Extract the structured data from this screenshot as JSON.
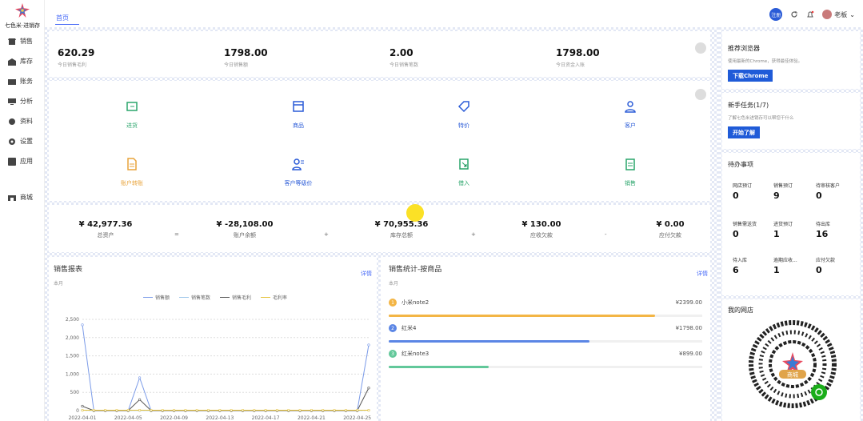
{
  "app": {
    "brand": "七色米·进销存"
  },
  "sidebar": {
    "items": [
      {
        "label": "销售",
        "icon": "store-icon"
      },
      {
        "label": "库存",
        "icon": "warehouse-icon"
      },
      {
        "label": "账务",
        "icon": "wallet-icon"
      },
      {
        "label": "分析",
        "icon": "monitor-icon"
      },
      {
        "label": "资料",
        "icon": "data-icon"
      },
      {
        "label": "设置",
        "icon": "gear-icon"
      },
      {
        "label": "应用",
        "icon": "app-icon"
      },
      {
        "label": "商城",
        "icon": "shop-icon"
      }
    ]
  },
  "topbar": {
    "breadcrumb": "首页",
    "badge": "注册",
    "user": "老板"
  },
  "stats": [
    {
      "value": "620.29",
      "label": "今日销售毛利"
    },
    {
      "value": "1798.00",
      "label": "今日销售额"
    },
    {
      "value": "2.00",
      "label": "今日销售笔数"
    },
    {
      "value": "1798.00",
      "label": "今日资金入账"
    }
  ],
  "quick": [
    {
      "label": "进货",
      "color": "#2aa56b"
    },
    {
      "label": "商品",
      "color": "#2a5bd7"
    },
    {
      "label": "特价",
      "color": "#2a5bd7"
    },
    {
      "label": "客户",
      "color": "#2a5bd7"
    },
    {
      "label": "账户转账",
      "color": "#e8a33a"
    },
    {
      "label": "客户等级价",
      "color": "#2a5bd7"
    },
    {
      "label": "借入",
      "color": "#2aa56b"
    },
    {
      "label": "销售",
      "color": "#2aa56b"
    }
  ],
  "balances": [
    {
      "value": "¥ 42,977.36",
      "label": "总资产"
    },
    {
      "value": "¥ -28,108.00",
      "label": "账户余额"
    },
    {
      "value": "¥ 70,955.36",
      "label": "库存总额"
    },
    {
      "value": "¥ 130.00",
      "label": "应收欠款"
    },
    {
      "value": "¥ 0.00",
      "label": "应付欠款"
    }
  ],
  "balance_ops": [
    "=",
    "+",
    "+",
    "-"
  ],
  "sales_report": {
    "title": "销售报表",
    "period": "本月",
    "detail": "详情",
    "chart_data": {
      "type": "line",
      "x": [
        "2022-04-01",
        "2022-04-05",
        "2022-04-09",
        "2022-04-13",
        "2022-04-17",
        "2022-04-21",
        "2022-04-25"
      ],
      "yticks": [
        "2,500",
        "2,000",
        "1,500",
        "1,000",
        "500",
        "0"
      ],
      "ylim": [
        0,
        2500
      ],
      "series": [
        {
          "name": "销售额",
          "color": "#7b9be8",
          "values": [
            2350,
            0,
            0,
            0,
            0,
            900,
            0,
            0,
            0,
            0,
            0,
            0,
            0,
            0,
            0,
            0,
            0,
            0,
            0,
            0,
            0,
            0,
            0,
            0,
            0,
            1798
          ]
        },
        {
          "name": "销售笔数",
          "color": "#9dc5ea",
          "values": [
            2,
            0,
            0,
            0,
            0,
            1,
            0,
            0,
            0,
            0,
            0,
            0,
            0,
            0,
            0,
            0,
            0,
            0,
            0,
            0,
            0,
            0,
            0,
            0,
            0,
            2
          ]
        },
        {
          "name": "销售毛利",
          "color": "#555555",
          "values": [
            120,
            0,
            0,
            0,
            0,
            300,
            0,
            0,
            0,
            0,
            0,
            0,
            0,
            0,
            0,
            0,
            0,
            0,
            0,
            0,
            0,
            0,
            0,
            0,
            0,
            620
          ]
        },
        {
          "name": "毛利率",
          "color": "#e5c23a",
          "values": [
            10,
            10,
            10,
            10,
            10,
            10,
            10,
            10,
            10,
            10,
            10,
            10,
            10,
            10,
            10,
            10,
            10,
            10,
            10,
            10,
            10,
            10,
            10,
            10,
            10,
            10
          ]
        }
      ]
    }
  },
  "product_stats": {
    "title": "销售统计-按商品",
    "period": "本月",
    "detail": "详情",
    "items": [
      {
        "rank": "1",
        "name": "小米note2",
        "price": "¥2399.00",
        "fraction": 0.85,
        "color": "#f3b545"
      },
      {
        "rank": "2",
        "name": "红米4",
        "price": "¥1798.00",
        "fraction": 0.64,
        "color": "#5b86e5"
      },
      {
        "rank": "3",
        "name": "红米note3",
        "price": "¥899.00",
        "fraction": 0.32,
        "color": "#62c89a"
      }
    ]
  },
  "right": {
    "browser": {
      "title": "推荐浏览器",
      "desc": "使用最新的Chrome，获得最佳体验。",
      "button": "下载Chrome"
    },
    "tasks": {
      "title": "新手任务(1/7)",
      "desc": "了解七色米进销存可以帮您干什么",
      "button": "开始了解"
    },
    "todo": {
      "title": "待办事项",
      "items": [
        {
          "label": "网店预订",
          "value": "0"
        },
        {
          "label": "销售预订",
          "value": "9"
        },
        {
          "label": "待审核客户",
          "value": "0"
        },
        {
          "label": "销售需送货",
          "value": "0"
        },
        {
          "label": "进货预订",
          "value": "1"
        },
        {
          "label": "待出库",
          "value": "16"
        },
        {
          "label": "待入库",
          "value": "6"
        },
        {
          "label": "逾期应收...",
          "value": "1"
        },
        {
          "label": "应付欠款",
          "value": "0"
        }
      ]
    },
    "shop": {
      "title": "我的网店",
      "qr_label": "商城"
    }
  }
}
